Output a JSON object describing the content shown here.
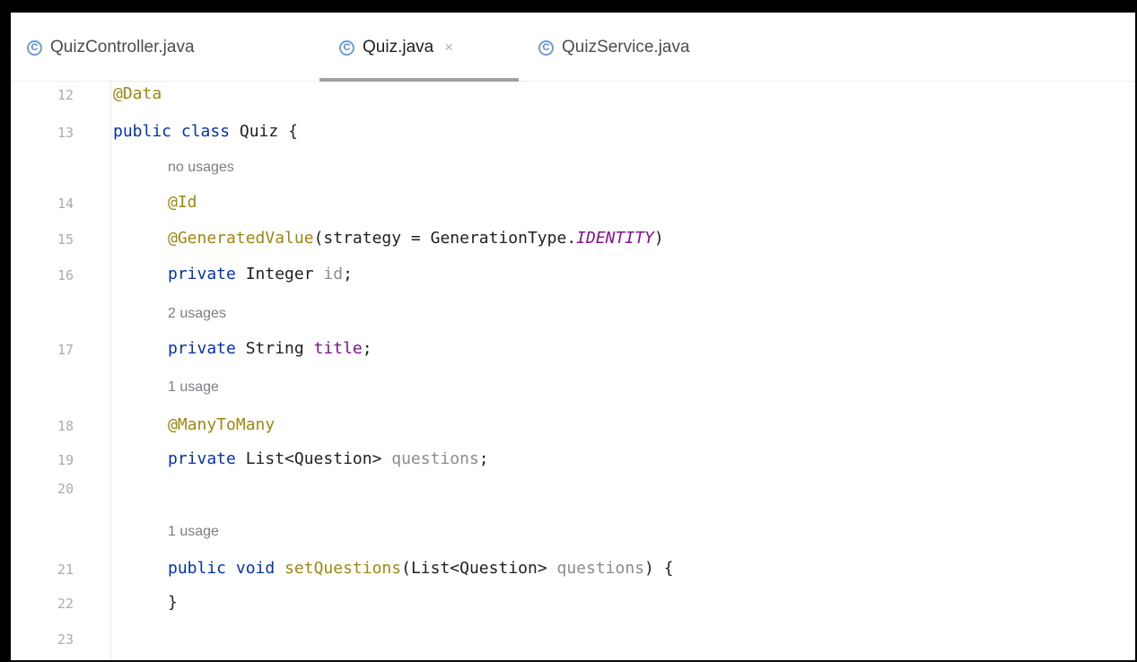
{
  "tabs": [
    {
      "label": "QuizController.java",
      "active": false
    },
    {
      "label": "Quiz.java",
      "active": true,
      "close": "×"
    },
    {
      "label": "QuizService.java",
      "active": false
    }
  ],
  "class_icon_glyph": "C",
  "colors": {
    "annotation": "#9e880d",
    "keyword": "#0033b3",
    "field": "#871094",
    "unused": "#8c8c8c",
    "line_number": "#a8abb0",
    "hint": "#7a7e85"
  },
  "lines": [
    {
      "num": "12",
      "segments": [
        {
          "t": "@Data",
          "c": "ann"
        }
      ]
    },
    {
      "num": "13",
      "segments": [
        {
          "t": "public class",
          "c": "kw"
        },
        {
          "t": " Quiz {",
          "c": ""
        }
      ]
    },
    {
      "hint": "no usages"
    },
    {
      "num": "14",
      "segments": [
        {
          "t": "@Id",
          "c": "ann"
        }
      ]
    },
    {
      "num": "15",
      "segments": [
        {
          "t": "@GeneratedValue",
          "c": "ann"
        },
        {
          "t": "(strategy = GenerationType.",
          "c": ""
        },
        {
          "t": "IDENTITY",
          "c": "const"
        },
        {
          "t": ")",
          "c": ""
        }
      ]
    },
    {
      "num": "16",
      "segments": [
        {
          "t": "private",
          "c": "kw"
        },
        {
          "t": " Integer ",
          "c": ""
        },
        {
          "t": "id",
          "c": "unused"
        },
        {
          "t": ";",
          "c": ""
        }
      ]
    },
    {
      "hint": "2 usages"
    },
    {
      "num": "17",
      "segments": [
        {
          "t": "private",
          "c": "kw"
        },
        {
          "t": " String ",
          "c": ""
        },
        {
          "t": "title",
          "c": "field"
        },
        {
          "t": ";",
          "c": ""
        }
      ]
    },
    {
      "hint": "1 usage"
    },
    {
      "num": "18",
      "segments": [
        {
          "t": "@ManyToMany",
          "c": "ann"
        }
      ]
    },
    {
      "num": "19",
      "segments": [
        {
          "t": "private",
          "c": "kw"
        },
        {
          "t": " List<Question> ",
          "c": ""
        },
        {
          "t": "questions",
          "c": "unused"
        },
        {
          "t": ";",
          "c": ""
        }
      ]
    },
    {
      "num": "20",
      "segments": []
    },
    {
      "hint": "1 usage"
    },
    {
      "num": "21",
      "segments": [
        {
          "t": "public void",
          "c": "kw"
        },
        {
          "t": " ",
          "c": ""
        },
        {
          "t": "setQuestions",
          "c": "ann"
        },
        {
          "t": "(List<Question> ",
          "c": ""
        },
        {
          "t": "questions",
          "c": "unused"
        },
        {
          "t": ") {",
          "c": ""
        }
      ]
    },
    {
      "num": "22",
      "segments": [
        {
          "t": "}",
          "c": ""
        }
      ]
    },
    {
      "num": "23",
      "segments": []
    }
  ]
}
